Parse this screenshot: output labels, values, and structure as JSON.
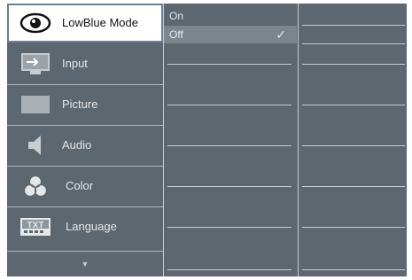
{
  "menu": {
    "items": [
      {
        "label": "LowBlue Mode",
        "icon": "eye-icon",
        "selected": true
      },
      {
        "label": "Input",
        "icon": "input-icon"
      },
      {
        "label": "Picture",
        "icon": "picture-icon"
      },
      {
        "label": "Audio",
        "icon": "speaker-icon"
      },
      {
        "label": "Color",
        "icon": "color-circles-icon"
      },
      {
        "label": "Language",
        "icon": "txt-icon"
      }
    ],
    "more_indicator": "▼"
  },
  "options": [
    {
      "label": "On",
      "checked": false
    },
    {
      "label": "Off",
      "checked": true
    }
  ],
  "check_mark": "✓",
  "language_icon_text": "TXT",
  "colors": {
    "panel": "#5d6770",
    "selected_bg": "#ffffff",
    "selected_border": "#6b7f96",
    "highlight_row": "#7b858d",
    "text": "#e4e8ea"
  }
}
